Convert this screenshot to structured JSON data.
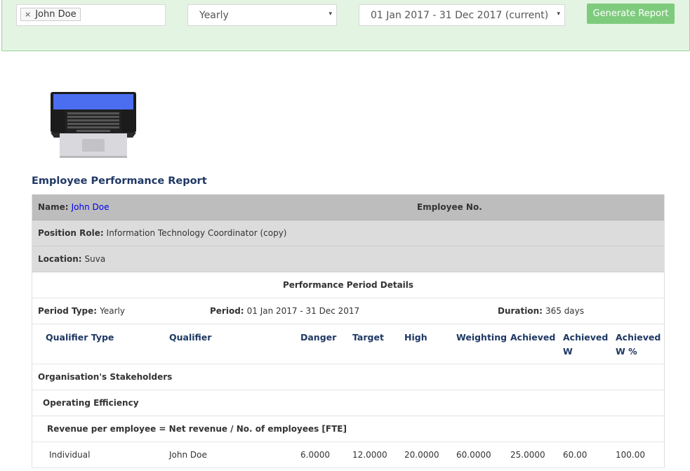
{
  "filters": {
    "employee_chip": "John Doe",
    "chip_remove": "×",
    "period_type": "Yearly",
    "period_range": "01 Jan 2017 - 31 Dec 2017 (current)",
    "caret": "▾",
    "generate_label": "Generate Report"
  },
  "report": {
    "title": "Employee Performance Report",
    "name_label": "Name:",
    "name_value": "John Doe",
    "employee_no_label": "Employee No.",
    "position_label": "Position Role:",
    "position_value": "Information Technology Coordinator (copy)",
    "location_label": "Location:",
    "location_value": "Suva",
    "period_details_heading": "Performance Period Details",
    "period_type_label": "Period Type:",
    "period_type_value": "Yearly",
    "period_label": "Period:",
    "period_value": "01 Jan 2017 - 31 Dec 2017",
    "duration_label": "Duration:",
    "duration_value": "365 days"
  },
  "table": {
    "columns": [
      "Qualifier Type",
      "Qualifier",
      "Danger",
      "Target",
      "High",
      "Weighting",
      "Achieved",
      "Achieved W",
      "Achieved W %"
    ],
    "group": "Organisation's Stakeholders",
    "subgroup": "Operating Efficiency",
    "measure": "Revenue per employee = Net revenue / No. of employees [FTE]",
    "rows": [
      {
        "qualifier_type": "Individual",
        "qualifier": "John Doe",
        "danger": "6.0000",
        "target": "12.0000",
        "high": "20.0000",
        "weighting": "60.0000",
        "achieved": "25.0000",
        "achieved_w": "60.00",
        "achieved_w_pct": "100.00"
      }
    ]
  },
  "colors": {
    "filter_bg": "#e4f4e3",
    "button": "#7ecb7e",
    "title": "#1f3864",
    "achieved_value": "#22dd22",
    "name_header_bg": "#bdbdbd",
    "info_row_bg": "#dcdcdc"
  },
  "icons": {
    "report_image": "laptop-icon"
  }
}
